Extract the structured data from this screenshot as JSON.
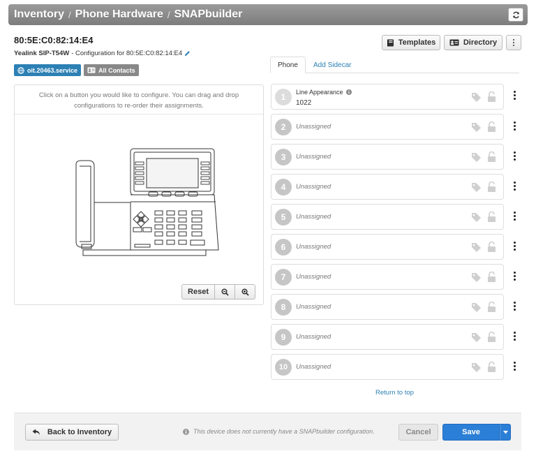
{
  "breadcrumb": [
    "Inventory",
    "Phone Hardware",
    "SNAPbuilder"
  ],
  "device": {
    "mac": "80:5E:C0:82:14:E4",
    "model": "Yealink SIP-T54W",
    "config_text": " - Configuration for 80:5E:C0:82:14:E4"
  },
  "badges": {
    "service": "oit.20463.service",
    "contacts": "All Contacts"
  },
  "toolbar": {
    "templates": "Templates",
    "directory": "Directory"
  },
  "tabs": {
    "phone": "Phone",
    "sidecar": "Add Sidecar"
  },
  "phone_panel": {
    "hint": "Click on a button you would like to configure. You can drag and drop configurations to re-order their assignments.",
    "reset": "Reset"
  },
  "keys": [
    {
      "number": "1",
      "title": "Line Appearance",
      "value": "1022"
    },
    {
      "number": "2",
      "label": "Unassigned"
    },
    {
      "number": "3",
      "label": "Unassigned"
    },
    {
      "number": "4",
      "label": "Unassigned"
    },
    {
      "number": "5",
      "label": "Unassigned"
    },
    {
      "number": "6",
      "label": "Unassigned"
    },
    {
      "number": "7",
      "label": "Unassigned"
    },
    {
      "number": "8",
      "label": "Unassigned"
    },
    {
      "number": "9",
      "label": "Unassigned"
    },
    {
      "number": "10",
      "label": "Unassigned"
    }
  ],
  "return_top": "Return to top",
  "footer": {
    "back": "Back to Inventory",
    "note": "This device does not currently have a SNAPbuilder configuration.",
    "cancel": "Cancel",
    "save": "Save"
  },
  "colors": {
    "accent_blue": "#2c7fd6",
    "link_blue": "#2c80b4",
    "titlebar_gray": "#8a8a8a"
  }
}
